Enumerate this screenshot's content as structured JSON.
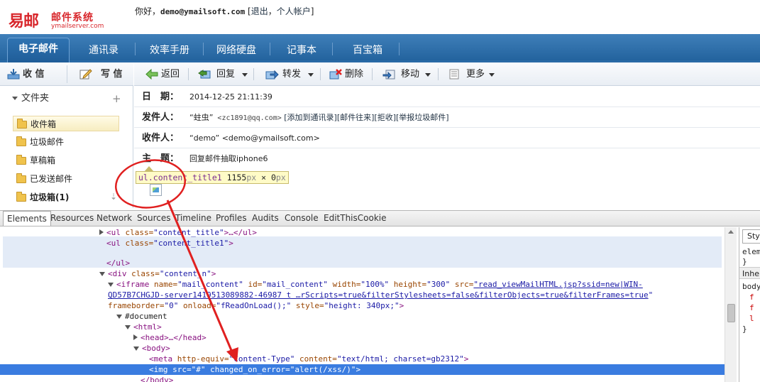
{
  "header": {
    "logo_main": "易邮",
    "logo_sub": "邮件系统",
    "logo_domain": "ymailserver.com",
    "greeting": "你好，",
    "user_email": "demo@ymailsoft.com",
    "bracket_open": " [",
    "logout": "退出",
    "comma": "，",
    "account": "个人帐户",
    "bracket_close": "]"
  },
  "nav": {
    "tabs": [
      {
        "label": "电子邮件"
      },
      {
        "label": "通讯录"
      },
      {
        "label": "效率手册"
      },
      {
        "label": "网络硬盘"
      },
      {
        "label": "记事本"
      },
      {
        "label": "百宝箱"
      }
    ]
  },
  "left": {
    "receive": "收 信",
    "compose": "写 信",
    "folders_title": "文件夹",
    "add": "+",
    "folders": [
      {
        "label": "收件箱"
      },
      {
        "label": "垃圾邮件"
      },
      {
        "label": "草稿箱"
      },
      {
        "label": "已发送邮件"
      },
      {
        "label": "垃圾箱(1)"
      }
    ]
  },
  "toolbar": {
    "back": "返回",
    "reply": "回复",
    "forward": "转发",
    "delete": "删除",
    "move": "移动",
    "more": "更多"
  },
  "mail": {
    "date_label": "日　期：",
    "date_value": "2014-12-25 21:11:39",
    "from_label": "发件人：",
    "from_name": "“蛀虫”",
    "from_email": " <zc1891@qq.com>",
    "from_actions": [
      {
        "label": "[添加到通讯录]"
      },
      {
        "label": "[邮件往来]"
      },
      {
        "label": "[拒收]"
      },
      {
        "label": "[举报垃圾邮件]"
      }
    ],
    "to_label": "收件人：",
    "to_value": "“demo” <demo@ymailsoft.com>",
    "subject_label": "主　题：",
    "subject_value": "回复邮件抽取iphone6"
  },
  "tooltip": {
    "selector": "ul.content_title1",
    "width": " 1155",
    "unit1": "px",
    "times": " × ",
    "height": "0",
    "unit2": "px"
  },
  "devtools": {
    "tabs": [
      {
        "label": "Elements"
      },
      {
        "label": "Resources"
      },
      {
        "label": "Network"
      },
      {
        "label": "Sources"
      },
      {
        "label": "Timeline"
      },
      {
        "label": "Profiles"
      },
      {
        "label": "Audits"
      },
      {
        "label": "Console"
      },
      {
        "label": "EditThisCookie"
      }
    ],
    "tree": {
      "l1_open": "<ul",
      "l1_attr": " class=",
      "l1_val": "\"content_title\"",
      "l1_rest": ">…</ul>",
      "l2_open": "<ul",
      "l2_attr": " class=",
      "l2_val": "\"content_title1\"",
      "l2_rest": ">",
      "l3": "</ul>",
      "l4_open": "<div",
      "l4_attr": " class=",
      "l4_val": "\"content_n\"",
      "l4_rest": ">",
      "l5_open": "<iframe",
      "l5_a1": " name=",
      "l5_v1": "\"mail_content\"",
      "l5_a2": " id=",
      "l5_v2": "\"mail_content\"",
      "l5_a3": " width=",
      "l5_v3": "\"100%\"",
      "l5_a4": " height=",
      "l5_v4": "\"300\"",
      "l5_a5": " src=",
      "l5_v5": "\"read_viewMailHTML.jsp?ssid=new|WIN-",
      "l6_v": "QD57B7CHGJD-server1419513089882-46987 t …rScripts=true&filterStylesheets=false&filterObjects=true&filterFrames=true",
      "l6_q": "\"",
      "l7_a1": "frameborder=",
      "l7_v1": "\"0\"",
      "l7_a2": " onload=",
      "l7_v2": "\"fReadOnLoad();\"",
      "l7_a3": " style=",
      "l7_v3": "\"height: 340px;\"",
      "l7_rest": ">",
      "l8": "#document",
      "l9": "<html>",
      "l10_open": "<head>",
      "l10_rest": "…</head>",
      "l11": "<body>",
      "l12_open": "<meta",
      "l12_a1": " http-equiv=",
      "l12_v1": "\"Content-Type\"",
      "l12_a2": " content=",
      "l12_v2": "\"text/html; charset=gb2312\"",
      "l12_rest": ">",
      "l13_open": "<img",
      "l13_a1": " src=",
      "l13_v1": "\"#\"",
      "l13_a2": " changed_on_error=",
      "l13_v2": "\"alert(/xss/)\"",
      "l13_rest": ">",
      "l14": "</body>"
    },
    "side": {
      "box": "Sty",
      "l1": "elem",
      "l2": "}",
      "head": "Inhe",
      "l3": "body",
      "l4": "f",
      "l5": "f",
      "l6": "l",
      "l7": "}"
    }
  },
  "colors": {
    "brand_red": "#d8262b",
    "nav_blue": "#2a6aa6",
    "annotation_red": "#e02020",
    "selected_row": "#3a7ce0"
  }
}
